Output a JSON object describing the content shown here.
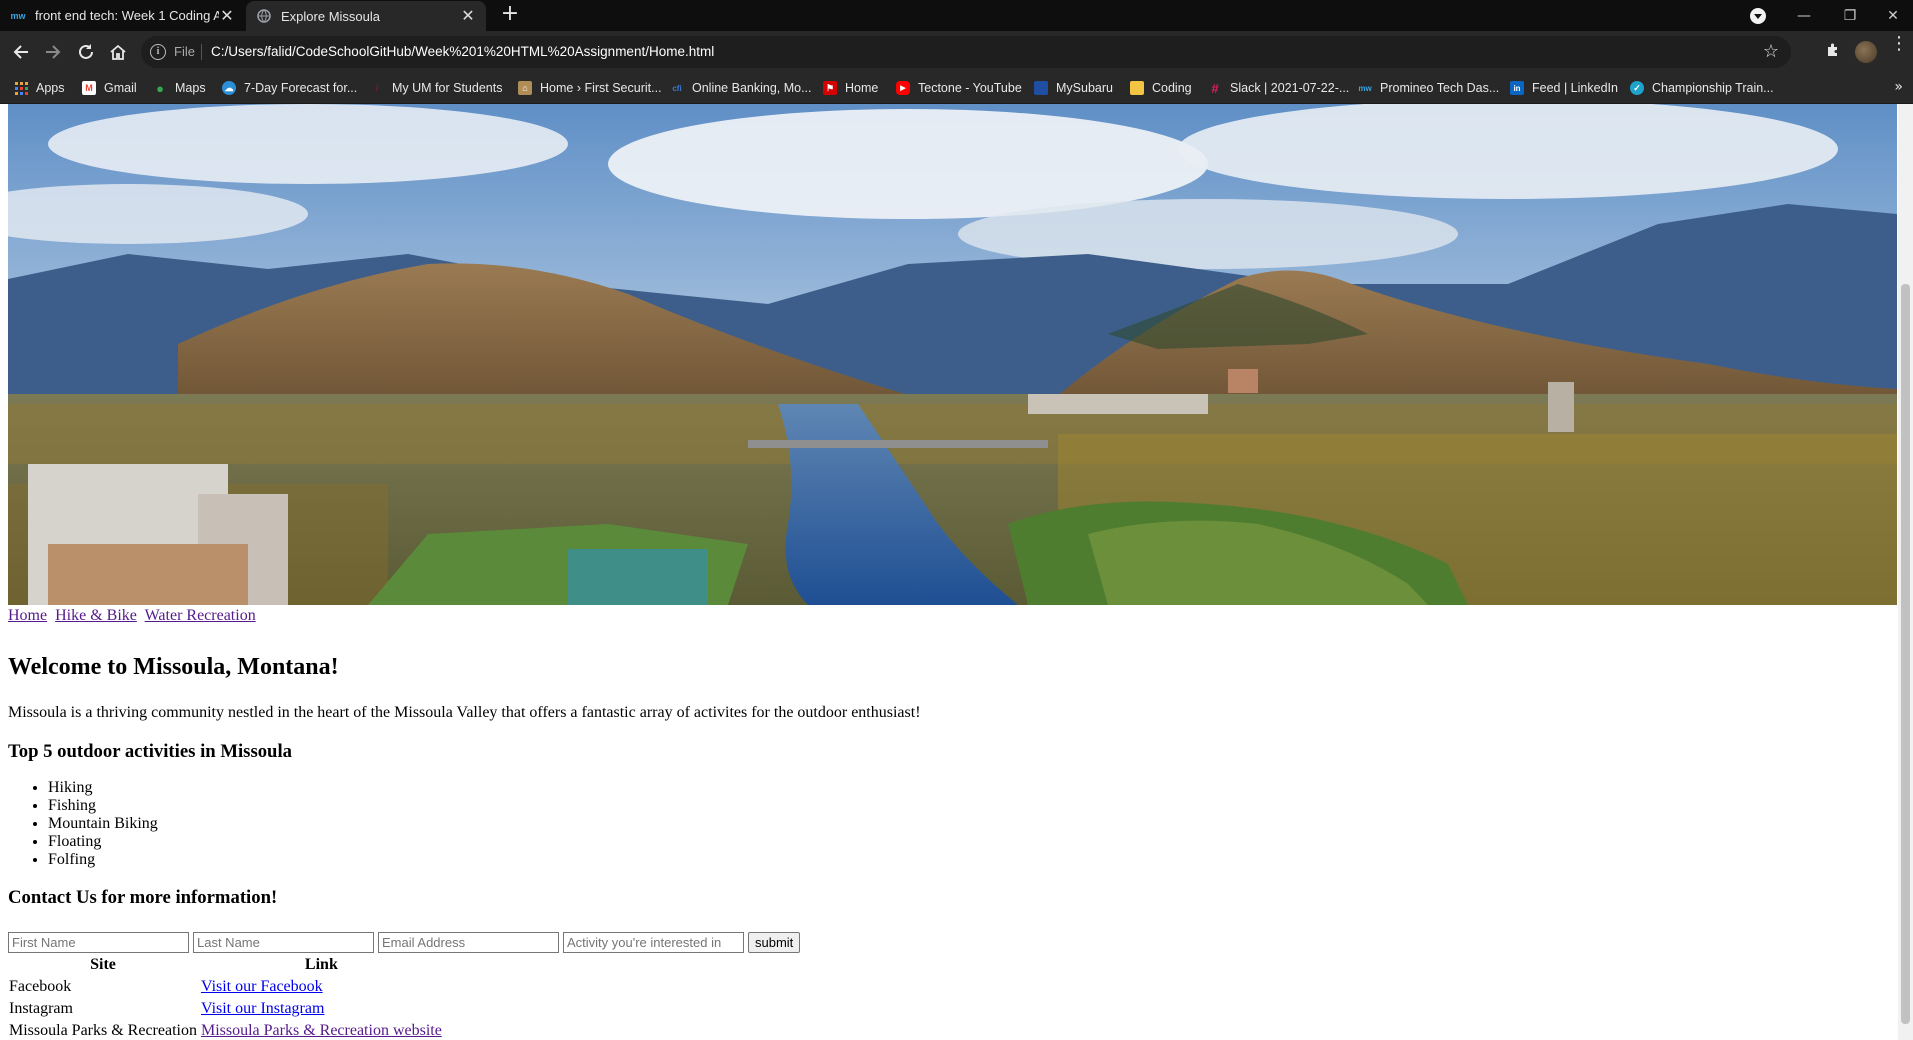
{
  "browser": {
    "tabs": [
      {
        "title": "front end tech: Week 1 Coding A",
        "favicon": "mw",
        "active": false
      },
      {
        "title": "Explore Missoula",
        "active": true
      }
    ],
    "address": {
      "scheme_label": "File",
      "url": "C:/Users/falid/CodeSchoolGitHub/Week%201%20HTML%20Assignment/Home.html"
    },
    "bookmarks": [
      {
        "label": "Apps",
        "icon": "apps-grid-icon",
        "color": "#e8a33c"
      },
      {
        "label": "Gmail",
        "icon": "gmail-icon",
        "color": "#ea4335"
      },
      {
        "label": "Maps",
        "icon": "maps-pin-icon",
        "color": "#34a853"
      },
      {
        "label": "7-Day Forecast for...",
        "icon": "weather-icon",
        "color": "#2a8fd8"
      },
      {
        "label": "My UM for Students",
        "icon": "um-icon",
        "color": "#7a1c2c"
      },
      {
        "label": "Home › First Securit...",
        "icon": "bank-icon",
        "color": "#b08d57"
      },
      {
        "label": "Online Banking, Mo...",
        "icon": "cfi-icon",
        "color": "#3a7bd5"
      },
      {
        "label": "Home",
        "icon": "home-flag-icon",
        "color": "#d50000"
      },
      {
        "label": "Tectone - YouTube",
        "icon": "youtube-icon",
        "color": "#ff0000"
      },
      {
        "label": "MySubaru",
        "icon": "subaru-icon",
        "color": "#1f4fa3"
      },
      {
        "label": "Coding",
        "icon": "folder-icon",
        "color": "#f4c542"
      },
      {
        "label": "Slack | 2021-07-22-...",
        "icon": "slack-icon",
        "color": "#e01e5a"
      },
      {
        "label": "Promineo Tech Das...",
        "icon": "mw-icon",
        "color": "#3aa5e0"
      },
      {
        "label": "Feed | LinkedIn",
        "icon": "linkedin-icon",
        "color": "#0a66c2"
      },
      {
        "label": "Championship Train...",
        "icon": "champ-icon",
        "color": "#1fa3c8"
      }
    ]
  },
  "page": {
    "nav": [
      {
        "label": "Home"
      },
      {
        "label": "Hike & Bike"
      },
      {
        "label": "Water Recreation"
      }
    ],
    "heading": "Welcome to Missoula, Montana!",
    "intro": "Missoula is a thriving community nestled in the heart of the Missoula Valley that offers a fantastic array of activites for the outdoor enthusiast!",
    "activities_heading": "Top 5 outdoor activities in Missoula",
    "activities": [
      "Hiking",
      "Fishing",
      "Mountain Biking",
      "Floating",
      "Folfing"
    ],
    "contact_heading": "Contact Us for more information!",
    "form": {
      "first_name_placeholder": "First Name",
      "last_name_placeholder": "Last Name",
      "email_placeholder": "Email Address",
      "activity_placeholder": "Activity you're interested in",
      "submit_label": "submit"
    },
    "table": {
      "headers": [
        "Site",
        "Link"
      ],
      "rows": [
        {
          "site": "Facebook",
          "link": "Visit our Facebook"
        },
        {
          "site": "Instagram",
          "link": "Visit our Instagram"
        },
        {
          "site": "Missoula Parks & Recreation",
          "link": "Missoula Parks & Recreation website"
        }
      ]
    }
  }
}
